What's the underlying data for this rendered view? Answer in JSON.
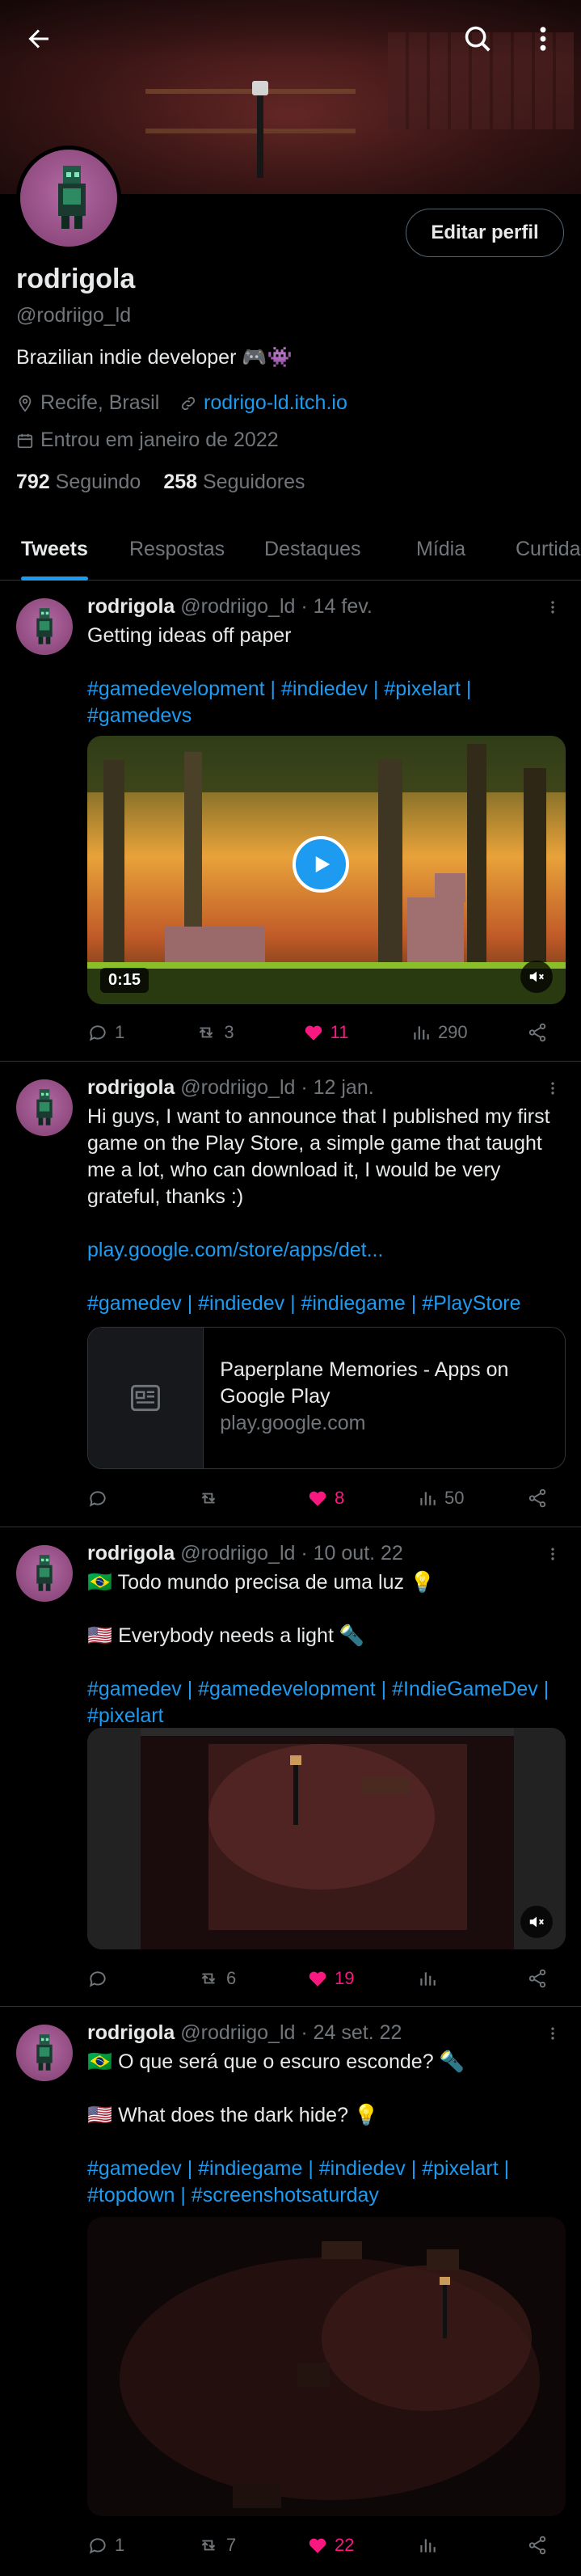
{
  "header": {
    "back_icon": "arrow-left-icon",
    "search_icon": "search-icon",
    "more_icon": "more-vertical-icon"
  },
  "profile": {
    "name": "rodrigola",
    "handle": "@rodriigo_ld",
    "bio": "Brazilian indie developer 🎮👾",
    "location": "Recife, Brasil",
    "website": "rodrigo-ld.itch.io",
    "joined": "Entrou em janeiro de 2022",
    "following_count": "792",
    "following_label": "Seguindo",
    "followers_count": "258",
    "followers_label": "Seguidores",
    "edit_button": "Editar perfil"
  },
  "tabs": [
    {
      "label": "Tweets",
      "active": true
    },
    {
      "label": "Respostas"
    },
    {
      "label": "Destaques"
    },
    {
      "label": "Mídia"
    },
    {
      "label": "Curtidas"
    }
  ],
  "tweets": [
    {
      "name": "rodrigola",
      "meta": "@rodriigo_ld · 14 fev.",
      "text": "Getting ideas off paper",
      "hashtags": "#gamedevelopment | #indiedev | #pixelart | #gamedevs",
      "video_duration": "0:15",
      "replies": "1",
      "retweets": "3",
      "likes": "11",
      "views": "290"
    },
    {
      "name": "rodrigola",
      "meta": "@rodriigo_ld · 12 jan.",
      "text": "Hi guys, I want to announce that I published my first game on the Play Store, a simple game that taught me a lot, who can download it, I would be very grateful, thanks :)",
      "link": "play.google.com/store/apps/det...",
      "hashtags": "#gamedev | #indiedev | #indiegame | #PlayStore",
      "card_title": "Paperplane Memories - Apps on Google Play",
      "card_domain": "play.google.com",
      "replies": "",
      "retweets": "",
      "likes": "8",
      "views": "50"
    },
    {
      "name": "rodrigola",
      "meta": "@rodriigo_ld · 10 out. 22",
      "text_pt": "🇧🇷 Todo mundo precisa de uma luz 💡",
      "text_en": "🇺🇸 Everybody needs a light 🔦",
      "hashtags": "#gamedev | #gamedevelopment | #IndieGameDev | #pixelart",
      "replies": "",
      "retweets": "6",
      "likes": "19",
      "views": ""
    },
    {
      "name": "rodrigola",
      "meta": "@rodriigo_ld · 24 set. 22",
      "text_pt": "🇧🇷 O que será que o escuro esconde? 🔦",
      "text_en": "🇺🇸 What does the dark hide? 💡",
      "hashtags": "#gamedev | #indiegame | #indiedev | #pixelart | #topdown | #screenshotsaturday",
      "replies": "1",
      "retweets": "7",
      "likes": "22",
      "views": ""
    }
  ],
  "colors": {
    "accent": "#1d9bf0",
    "like": "#f91880",
    "muted": "#71767b",
    "background": "#000000"
  }
}
